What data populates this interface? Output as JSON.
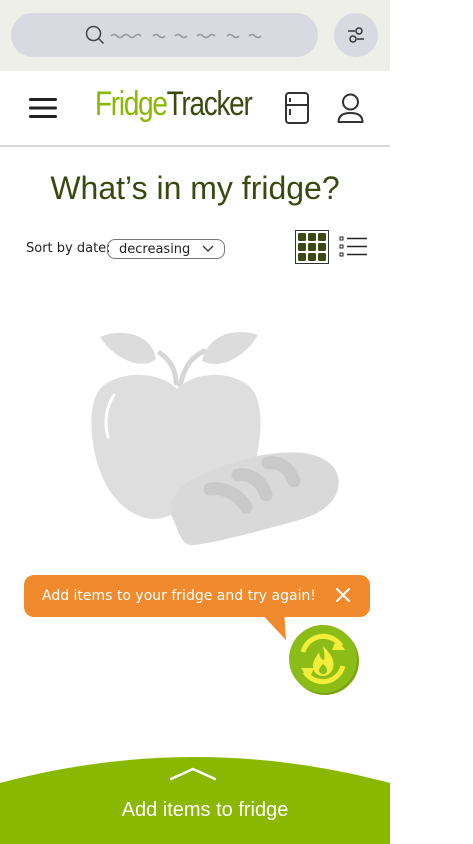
{
  "search": {
    "placeholder_scribble": "search fridge items"
  },
  "brand": {
    "part1": "Fridge",
    "part2": "Tracker",
    "color_primary": "#8ab800",
    "color_dark": "#3a4a12"
  },
  "page": {
    "title": "What’s in my fridge?"
  },
  "sort": {
    "label": "Sort by date:",
    "value": "decreasing"
  },
  "views": {
    "selected": "grid"
  },
  "empty_state": {
    "illustration": "apple-and-bread"
  },
  "toast": {
    "message": "Add items to your fridge and try again!",
    "color": "#f08a2c"
  },
  "bottom_sheet": {
    "label": "Add items to fridge",
    "color": "#8ab800"
  }
}
